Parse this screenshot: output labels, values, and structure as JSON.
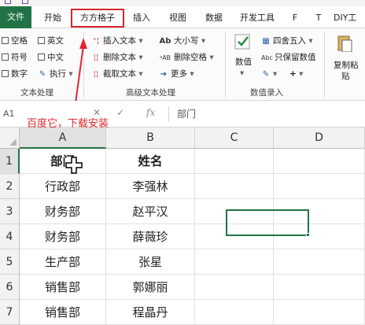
{
  "tabs": [
    {
      "key": "file",
      "label": "文件"
    },
    {
      "key": "home",
      "label": "开始"
    },
    {
      "key": "ffgz",
      "label": "方方格子"
    },
    {
      "key": "insert",
      "label": "插入"
    },
    {
      "key": "view",
      "label": "视图"
    },
    {
      "key": "data",
      "label": "数据"
    },
    {
      "key": "dev",
      "label": "开发工具"
    },
    {
      "key": "f",
      "label": "F"
    },
    {
      "key": "t",
      "label": "T"
    },
    {
      "key": "diy",
      "label": "DIY工"
    }
  ],
  "ribbon": {
    "text_group": {
      "label": "文本处理",
      "chk_space": "空格",
      "chk_english": "英文",
      "chk_symbol": "符号",
      "chk_chinese": "中文",
      "chk_digit": "数字",
      "execute": "执行"
    },
    "adv_group": {
      "label": "高级文本处理",
      "insert_text": "插入文本",
      "delete_text": "删除文本",
      "extract_text": "截取文本",
      "case": "大小写",
      "delete_space": "删除空格",
      "more": "更多"
    },
    "num_group": {
      "label": "数值录入",
      "value": "数值",
      "round": "四舍五入",
      "keep_value": "只保留数值",
      "plus": "+"
    },
    "paste": {
      "label1": "复制粘",
      "label2": "贴"
    }
  },
  "formula_bar": {
    "name_box": "A1",
    "fx": "fx",
    "value": "部门",
    "annotation": "百度它，下载安装"
  },
  "sheet": {
    "columns": [
      "A",
      "B",
      "C",
      "D"
    ],
    "rows": [
      "1",
      "2",
      "3",
      "4",
      "5",
      "6",
      "7"
    ],
    "data": [
      [
        "部门",
        "姓名"
      ],
      [
        "行政部",
        "李强林"
      ],
      [
        "财务部",
        "赵平汉"
      ],
      [
        "财务部",
        "薛薇珍"
      ],
      [
        "生产部",
        "张星"
      ],
      [
        "销售部",
        "郭娜丽"
      ],
      [
        "销售部",
        "程晶丹"
      ]
    ]
  },
  "colors": {
    "accent": "#217346",
    "highlight": "#d9262c"
  }
}
